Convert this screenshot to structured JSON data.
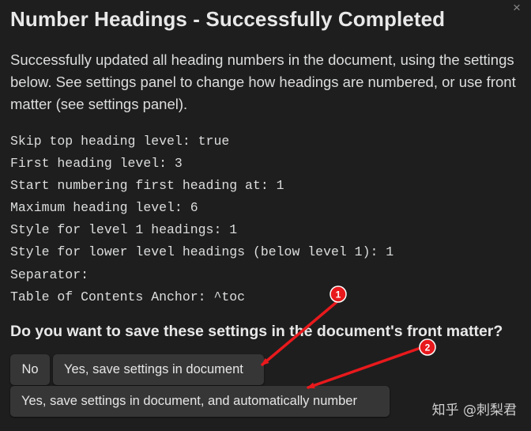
{
  "dialog": {
    "title": "Number Headings - Successfully Completed",
    "close_glyph": "×",
    "description": "Successfully updated all heading numbers in the document, using the settings below. See settings panel to change how headings are numbered, or use front matter (see settings panel).",
    "settings_lines": [
      "Skip top heading level: true",
      "First heading level: 3",
      "Start numbering first heading at: 1",
      "Maximum heading level: 6",
      "Style for level 1 headings: 1",
      "Style for lower level headings (below level 1): 1",
      "Separator:",
      "Table of Contents Anchor: ^toc"
    ],
    "question": "Do you want to save these settings in the document's front matter?",
    "buttons": {
      "no": "No",
      "yes": "Yes, save settings in document",
      "yes_auto": "Yes, save settings in document, and automatically number"
    }
  },
  "annotations": {
    "badge_1": "1",
    "badge_2": "2",
    "color": "#e8191c"
  },
  "watermark": "知乎 @刺梨君"
}
